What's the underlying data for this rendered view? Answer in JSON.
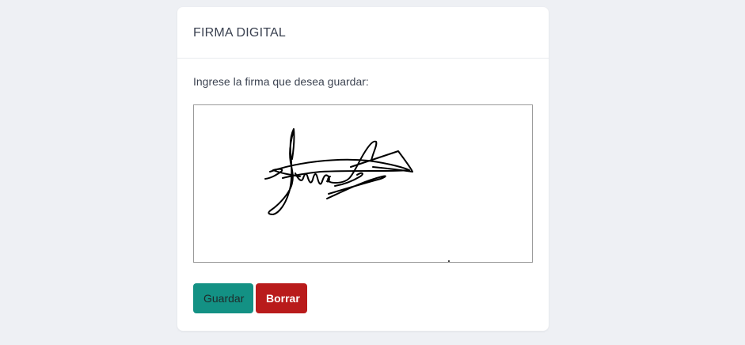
{
  "card": {
    "title": "FIRMA DIGITAL",
    "prompt": "Ingrese la firma que desea guardar:"
  },
  "buttons": {
    "save_label": "Guardar",
    "clear_label": "Borrar"
  },
  "colors": {
    "save_bg": "#139184",
    "save_text": "#1e2a2a",
    "clear_bg": "#b91b1b",
    "clear_text": "#ffffff",
    "ink": "#000000"
  }
}
